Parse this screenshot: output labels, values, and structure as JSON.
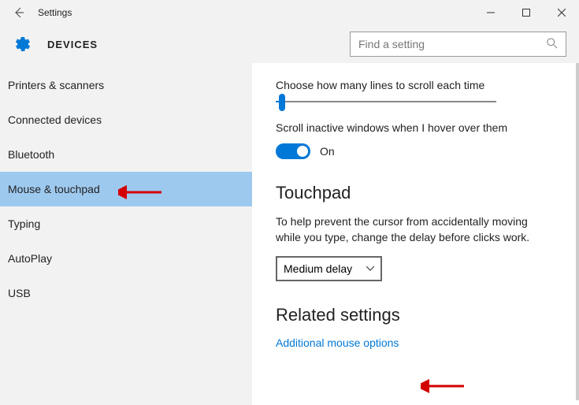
{
  "titlebar": {
    "title": "Settings"
  },
  "header": {
    "title": "DEVICES"
  },
  "search": {
    "placeholder": "Find a setting"
  },
  "sidebar": {
    "items": [
      {
        "label": "Printers & scanners"
      },
      {
        "label": "Connected devices"
      },
      {
        "label": "Bluetooth"
      },
      {
        "label": "Mouse & touchpad"
      },
      {
        "label": "Typing"
      },
      {
        "label": "AutoPlay"
      },
      {
        "label": "USB"
      }
    ]
  },
  "main": {
    "scroll_label": "Choose how many lines to scroll each time",
    "hover_label": "Scroll inactive windows when I hover over them",
    "toggle_state": "On",
    "touchpad_heading": "Touchpad",
    "touchpad_desc": "To help prevent the cursor from accidentally moving while you type, change the delay before clicks work.",
    "delay_value": "Medium delay",
    "related_heading": "Related settings",
    "related_link": "Additional mouse options"
  }
}
